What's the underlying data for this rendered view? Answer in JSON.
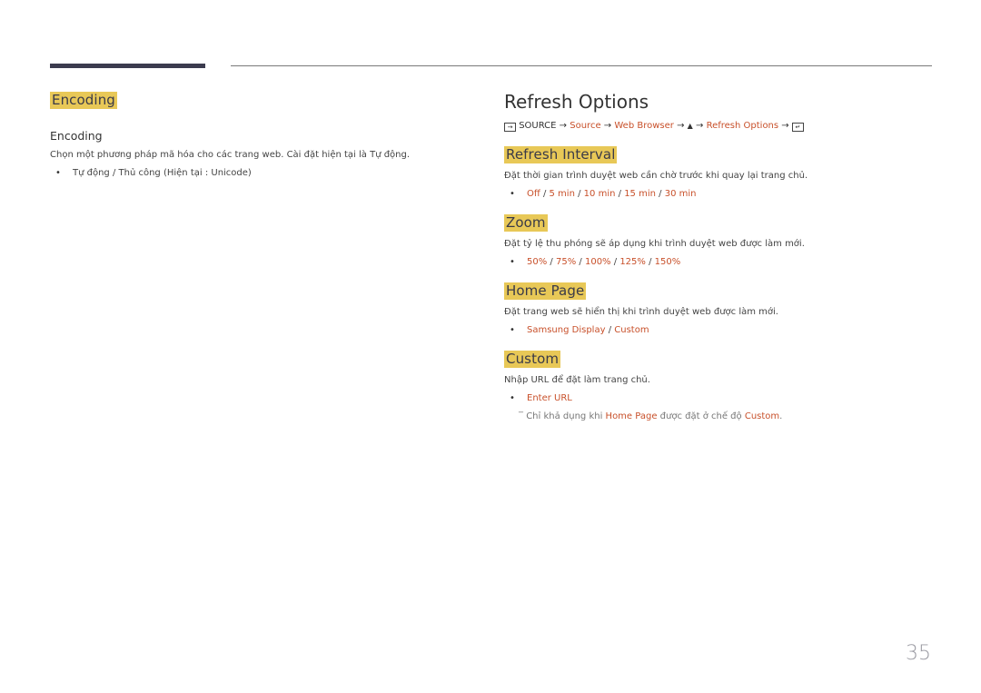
{
  "left": {
    "section_title": "Encoding",
    "item_title": "Encoding",
    "description": "Chọn một phương pháp mã hóa cho các trang web. Cài đặt hiện tại là Tự động.",
    "options": "Tự động / Thủ công (Hiện tại : Unicode)"
  },
  "right": {
    "title": "Refresh Options",
    "path": {
      "source_icon": "source-input-icon",
      "source_label": "SOURCE",
      "arrow": "→",
      "step1": "Source",
      "step2": "Web Browser",
      "up_icon": "▲",
      "step3": "Refresh Options",
      "enter_icon": "enter-icon"
    },
    "sections": [
      {
        "title": "Refresh Interval",
        "description": "Đặt thời gian trình duyệt web cần chờ trước khi quay lại trang chủ.",
        "options": [
          "Off",
          "5 min",
          "10 min",
          "15 min",
          "30 min"
        ]
      },
      {
        "title": "Zoom",
        "description": "Đặt tỷ lệ thu phóng sẽ áp dụng khi trình duyệt web được làm mới.",
        "options": [
          "50%",
          "75%",
          "100%",
          "125%",
          "150%"
        ]
      },
      {
        "title": "Home Page",
        "description": "Đặt trang web sẽ hiển thị khi trình duyệt web được làm mới.",
        "options": [
          "Samsung Display",
          "Custom"
        ]
      },
      {
        "title": "Custom",
        "description": "Nhập URL để đặt làm trang chủ.",
        "options": [
          "Enter URL"
        ],
        "note": {
          "prefix": "Chỉ khả dụng khi",
          "link1": "Home Page",
          "middle": "được đặt ở chế độ",
          "link2": "Custom",
          "suffix": "."
        }
      }
    ]
  },
  "page_number": "35",
  "colors": {
    "highlight": "#e8c857",
    "link": "#c8502a"
  }
}
